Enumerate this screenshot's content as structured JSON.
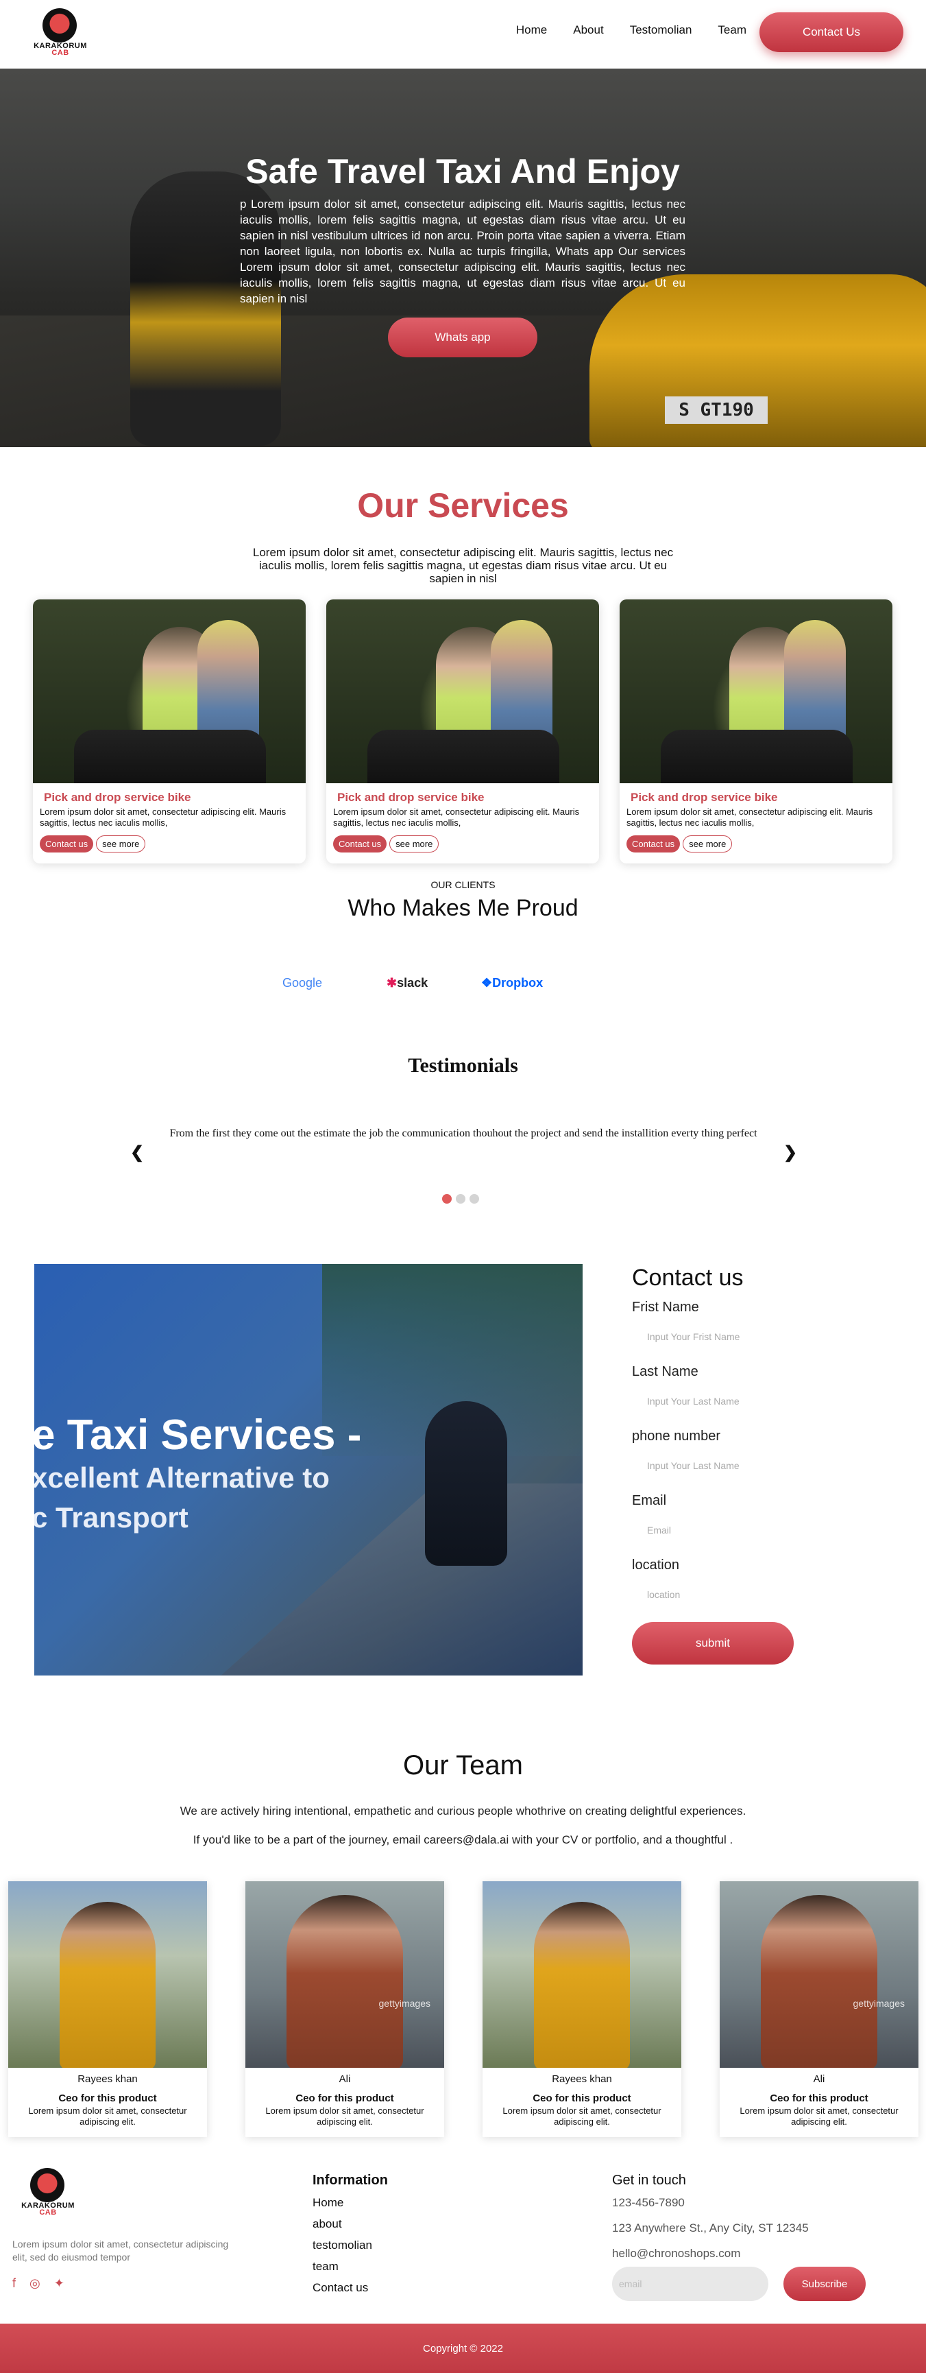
{
  "brand": {
    "name": "KARAKORUM",
    "sub": "CAB"
  },
  "nav": {
    "links": [
      "Home",
      "About",
      "Testomolian",
      "Team"
    ],
    "contact_label": "Contact Us"
  },
  "hero": {
    "title": "Safe Travel Taxi And Enjoy",
    "paragraph": "p Lorem ipsum dolor sit amet, consectetur adipiscing elit. Mauris sagittis, lectus nec iaculis mollis, lorem felis sagittis magna, ut egestas diam risus vitae arcu. Ut eu sapien in nisl vestibulum ultrices id non arcu. Proin porta vitae sapien a viverra. Etiam non laoreet ligula, non lobortis ex. Nulla ac turpis fringilla, Whats app Our services Lorem ipsum dolor sit amet, consectetur adipiscing elit. Mauris sagittis, lectus nec iaculis mollis, lorem felis sagittis magna, ut egestas diam risus vitae arcu. Ut eu sapien in nisl",
    "button_label": "Whats app",
    "plate_text": "S GT190"
  },
  "services": {
    "title": "Our Services",
    "description": "Lorem ipsum dolor sit amet, consectetur adipiscing elit. Mauris sagittis, lectus nec iaculis mollis, lorem felis sagittis magna, ut egestas diam risus vitae arcu. Ut eu sapien in nisl",
    "cards": [
      {
        "title": "Pick and drop service bike",
        "text": "Lorem ipsum dolor sit amet, consectetur adipiscing elit. Mauris sagittis, lectus nec iaculis mollis,",
        "contact_label": "Contact us",
        "more_label": "see more"
      },
      {
        "title": "Pick and drop service bike",
        "text": "Lorem ipsum dolor sit amet, consectetur adipiscing elit. Mauris sagittis, lectus nec iaculis mollis,",
        "contact_label": "Contact us",
        "more_label": "see more"
      },
      {
        "title": "Pick and drop service bike",
        "text": "Lorem ipsum dolor sit amet, consectetur adipiscing elit. Mauris sagittis, lectus nec iaculis mollis,",
        "contact_label": "Contact us",
        "more_label": "see more"
      }
    ]
  },
  "clients": {
    "label": "OUR CLIENTS",
    "title": "Who Makes Me Proud",
    "logos": [
      "Google",
      "slack",
      "Dropbox"
    ]
  },
  "testimonials": {
    "title": "Testimonials",
    "text": "From the first they come out the estimate the job the communication thouhout the project and send the installition everty thing perfect",
    "prev_icon": "❮",
    "next_icon": "❯",
    "active_slide": 1,
    "total_slides": 3
  },
  "contact": {
    "image_lines": [
      "e Taxi Services -",
      "xcellent Alternative to",
      "c Transport"
    ],
    "title": "Contact us",
    "fields": [
      {
        "label": "Frist Name",
        "placeholder": "Input Your Frist Name"
      },
      {
        "label": "Last Name",
        "placeholder": "Input Your Last Name"
      },
      {
        "label": "phone number",
        "placeholder": "Input Your Last Name"
      },
      {
        "label": "Email",
        "placeholder": "Email"
      },
      {
        "label": "location",
        "placeholder": "location"
      }
    ],
    "submit_label": "submit"
  },
  "team": {
    "title": "Our Team",
    "description": "We are actively hiring intentional, empathetic and curious people whothrive on creating delightful experiences. If you'd like to be a part of the journey, email careers@dala.ai with your CV or portfolio, and a thoughtful .",
    "members": [
      {
        "name": "Rayees khan",
        "role": "Ceo for this product",
        "text": "Lorem ipsum dolor sit amet, consectetur adipiscing elit."
      },
      {
        "name": "Ali",
        "role": "Ceo for this product",
        "text": "Lorem ipsum dolor sit amet, consectetur adipiscing elit.",
        "watermark": "gettyimages"
      },
      {
        "name": "Rayees khan",
        "role": "Ceo for this product",
        "text": "Lorem ipsum dolor sit amet, consectetur adipiscing elit."
      },
      {
        "name": "Ali",
        "role": "Ceo for this product",
        "text": "Lorem ipsum dolor sit amet, consectetur adipiscing elit.",
        "watermark": "gettyimages"
      }
    ]
  },
  "footer": {
    "about": "Lorem ipsum dolor sit amet, consectetur adipiscing elit, sed do eiusmod tempor",
    "social_icons": [
      "facebook-icon",
      "instagram-icon",
      "twitter-icon"
    ],
    "info_title": "Information",
    "info_links": [
      "Home",
      "about",
      "testomolian",
      "team",
      "Contact us"
    ],
    "touch_title": "Get in touch",
    "phone": "123-456-7890",
    "address": "123 Anywhere St., Any City, ST 12345",
    "email": "hello@chronoshops.com",
    "email_placeholder": "email",
    "subscribe_label": "Subscribe",
    "copyright": "Copyright © 2022"
  },
  "colors": {
    "accent": "#c94a52",
    "accent_gradient_top": "#e0606a",
    "accent_gradient_bottom": "#c0343f",
    "dot_active": "#e05a5a",
    "dot_inactive": "#d4d4d4"
  }
}
